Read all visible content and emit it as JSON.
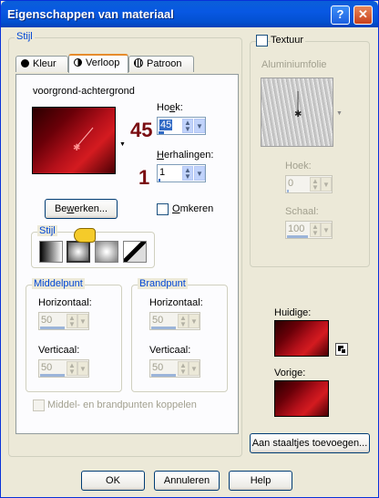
{
  "window": {
    "title": "Eigenschappen van materiaal",
    "help_glyph": "?",
    "close_glyph": "✕"
  },
  "stijl_group": {
    "legend": "Stijl",
    "tabs": [
      {
        "label": "Kleur",
        "icon": "filled-circle-icon"
      },
      {
        "label": "Verloop",
        "icon": "half-circle-icon"
      },
      {
        "label": "Patroon",
        "icon": "pattern-icon"
      }
    ],
    "gradient_name": "voorgrond-achtergrond",
    "hoek": {
      "label_pre": "Ho",
      "label_u": "e",
      "label_post": "k:",
      "value": "45",
      "annotation": "45"
    },
    "herhalingen": {
      "label_pre": "",
      "label_u": "H",
      "label_post": "erhalingen:",
      "value": "1",
      "annotation": "1"
    },
    "bewerken": {
      "label_pre": "Be",
      "label_u": "w",
      "label_post": "erken..."
    },
    "omkeren": {
      "label_pre": "",
      "label_u": "O",
      "label_post": "mkeren",
      "checked": false
    },
    "stijl_sub": {
      "legend": "Stijl"
    },
    "middelpunt": {
      "legend": "Middelpunt",
      "horizontaal": {
        "label": "Horizontaal:",
        "value": "50"
      },
      "verticaal": {
        "label": "Verticaal:",
        "value": "50"
      }
    },
    "brandpunt": {
      "legend": "Brandpunt",
      "horizontaal": {
        "label": "Horizontaal:",
        "value": "50"
      },
      "verticaal": {
        "label": "Verticaal:",
        "value": "50"
      }
    },
    "koppelen": {
      "label": "Middel- en brandpunten koppelen",
      "checked": false
    }
  },
  "textuur_group": {
    "legend": "Textuur",
    "checked": false,
    "texture_name": "Aluminiumfolie",
    "hoek": {
      "label": "Hoek:",
      "value": "0"
    },
    "schaal": {
      "label": "Schaal:",
      "value": "100"
    }
  },
  "huidige": {
    "label": "Huidige:"
  },
  "vorige": {
    "label": "Vorige:"
  },
  "aan_staaltjes": {
    "label": "Aan staaltjes toevoegen..."
  },
  "buttons": {
    "ok": "OK",
    "annuleren": "Annuleren",
    "help": "Help"
  },
  "colors": {
    "accent": "#0046d5",
    "title_bar": "#0858e3",
    "gradient_dark": "#2a0000",
    "gradient_red": "#d41b20"
  }
}
